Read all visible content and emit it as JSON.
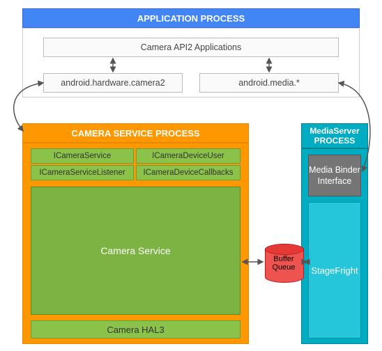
{
  "app": {
    "title": "APPLICATION PROCESS",
    "api_box": "Camera API2 Applications",
    "hw_camera": "android.hardware.camera2",
    "media": "android.media.*"
  },
  "camsvc": {
    "title": "CAMERA SERVICE PROCESS",
    "cells": {
      "c1": "ICameraService",
      "c2": "ICameraDeviceUser",
      "c3": "ICameraServiceListener",
      "c4": "ICameraDeviceCallbacks"
    },
    "main": "Camera Service",
    "hal": "Camera HAL3"
  },
  "mediaserver": {
    "title": "MediaServer PROCESS",
    "binder": "Media Binder Interface",
    "stage": "StageFright"
  },
  "buffer": {
    "l1": "Buffer",
    "l2": "Queue"
  }
}
